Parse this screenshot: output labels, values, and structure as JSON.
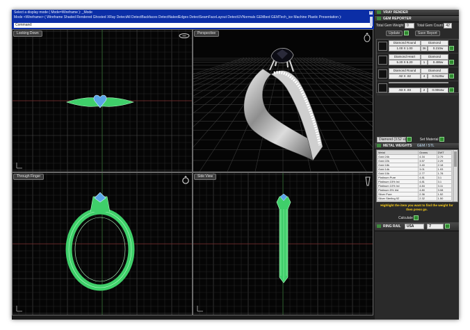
{
  "command": {
    "line1": "Select a display mode ( Mode=Wireframe ): _Mode",
    "line2": "Mode <Wireframe> ( Wireframe  Shaded  Rendered  Ghosted  XRay  DetectAll  DetectBackfaces  DetectNakedEdges  DetectSeamFaceLayout  DetectUVNormals  GEMbed  GEMTech_ice  Machine  Plastic  Presentation ):",
    "line3": "Command:"
  },
  "viewports": {
    "top_left": "Looking Down",
    "top_right": "Perspective",
    "bottom_left": "Through Finger",
    "bottom_right": "Side View"
  },
  "panel": {
    "vray": {
      "title": "VRAY RENDER"
    },
    "gem_reporter": {
      "title": "GEM REPORTER",
      "total_weight_label": "Total Gem Weight",
      "total_weight_value": "0",
      "total_count_label": "Total Gem Count",
      "total_count_value": "42",
      "update_button": "Update",
      "save_report_button": "Save Report",
      "rows": [
        {
          "name_a": "Diamond Round",
          "name_b": "Diamond",
          "size": "1.00 X 1.00",
          "count": "36",
          "weight": "0.210w"
        },
        {
          "name_a": "Diamond Heart",
          "name_b": "Diamond",
          "size": "5.20 X 5.20",
          "count": "1",
          "weight": "0.495w"
        },
        {
          "name_a": "Diamond Round",
          "name_b": "Diamond",
          "size": ".92 X .92",
          "count": "4",
          "weight": "0.0120w"
        },
        {
          "name_a": "",
          "name_b": "",
          "size": ".93 X .93",
          "count": "2",
          "weight": "0.0064w"
        }
      ],
      "material_value": "Diamond",
      "material_weight": "(3.52 s/g)",
      "set_material_button": "Set Material"
    },
    "metal_weights": {
      "title": "METAL WEIGHTS",
      "tab": "GEM / STL",
      "headers": [
        "Metal",
        "Grams",
        "DWT"
      ],
      "rows": [
        [
          "Gold 24k",
          "4.34",
          "2.79"
        ],
        [
          "Gold 22k",
          "3.57",
          "2.29"
        ],
        [
          "Gold 18k",
          "3.40",
          "2.18"
        ],
        [
          "Gold 14k",
          "3.01",
          "1.93"
        ],
        [
          "Gold 10k",
          "2.77",
          "1.78"
        ],
        [
          "Platinum Pure",
          "4.81",
          "3.1"
        ],
        [
          "Platinum 15% Ird",
          "4.81",
          "3.1"
        ],
        [
          "Platinum 10% Ird",
          "4.84",
          "3.11"
        ],
        [
          "Platinum 5% Irid",
          "4.80",
          "3.08"
        ],
        [
          "Silver Pure",
          "2.36",
          "1.52"
        ],
        [
          "Silver Sterling 92",
          "2.32",
          "1.50"
        ]
      ],
      "hint": "Highlight the item you want to find the weight for then press go.",
      "calculate_button": "Calculate"
    },
    "ring_rail": {
      "title": "RING RAIL",
      "system_value": "USA",
      "size_value": "7"
    }
  }
}
